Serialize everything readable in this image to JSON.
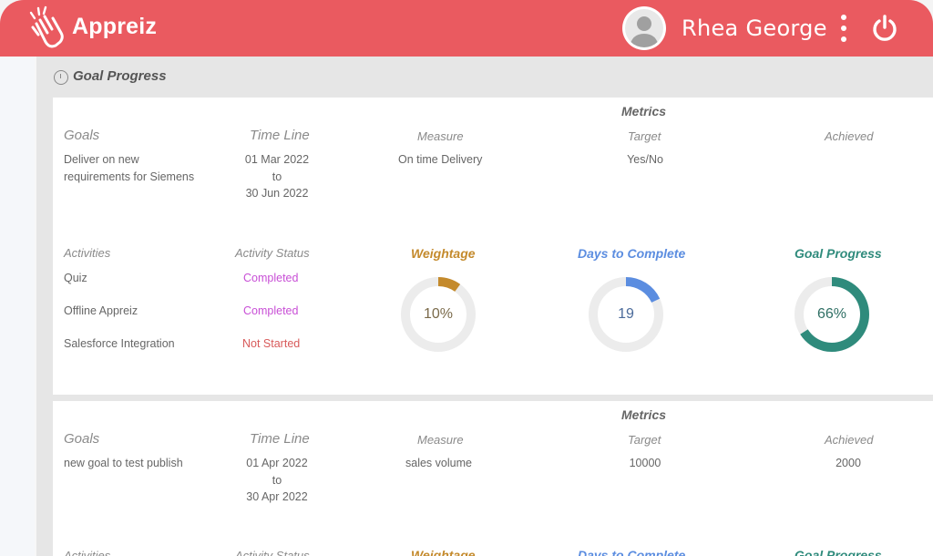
{
  "app": {
    "brand": "Appreiz"
  },
  "header": {
    "user_name": "Rhea George"
  },
  "panel": {
    "title": "Goal Progress"
  },
  "labels": {
    "goals": "Goals",
    "time_line": "Time Line",
    "metrics": "Metrics",
    "measure": "Measure",
    "target": "Target",
    "achieved": "Achieved",
    "activities": "Activities",
    "activity_status": "Activity Status",
    "weightage": "Weightage",
    "days_to_complete": "Days to Complete",
    "goal_progress": "Goal Progress",
    "to": "to"
  },
  "goals": [
    {
      "goal": "Deliver on new requirements for Siemens",
      "goal_line1": "Deliver on new",
      "goal_line2": "requirements for Siemens",
      "start": "01 Mar 2022",
      "end": "30 Jun 2022",
      "measure": "On time Delivery",
      "target": "Yes/No",
      "achieved": "",
      "activities": [
        {
          "name": "Quiz",
          "status": "Completed"
        },
        {
          "name": "Offline Appreiz",
          "status": "Completed"
        },
        {
          "name": "Salesforce Integration",
          "status": "Not Started"
        }
      ],
      "weightage": {
        "label": "10%",
        "fraction": 0.1
      },
      "days_to_complete": {
        "label": "19",
        "fraction": 0.18
      },
      "goal_progress": {
        "label": "66%",
        "fraction": 0.66
      }
    },
    {
      "goal": "new goal to test publish",
      "start": "01 Apr 2022",
      "end": "30 Apr 2022",
      "measure": "sales volume",
      "target": "10000",
      "achieved": "2000"
    }
  ],
  "colors": {
    "header_bg": "#ea5a60",
    "weightage": "#c48a2c",
    "days": "#5b8de0",
    "progress": "#2f8b7c",
    "completed": "#c84fd6",
    "not_started": "#d85a5a",
    "ring_track": "#ececec"
  },
  "icons": [
    "clapping-hand-logo-icon",
    "user-avatar-icon",
    "kebab-menu-icon",
    "power-icon",
    "clock-icon"
  ]
}
